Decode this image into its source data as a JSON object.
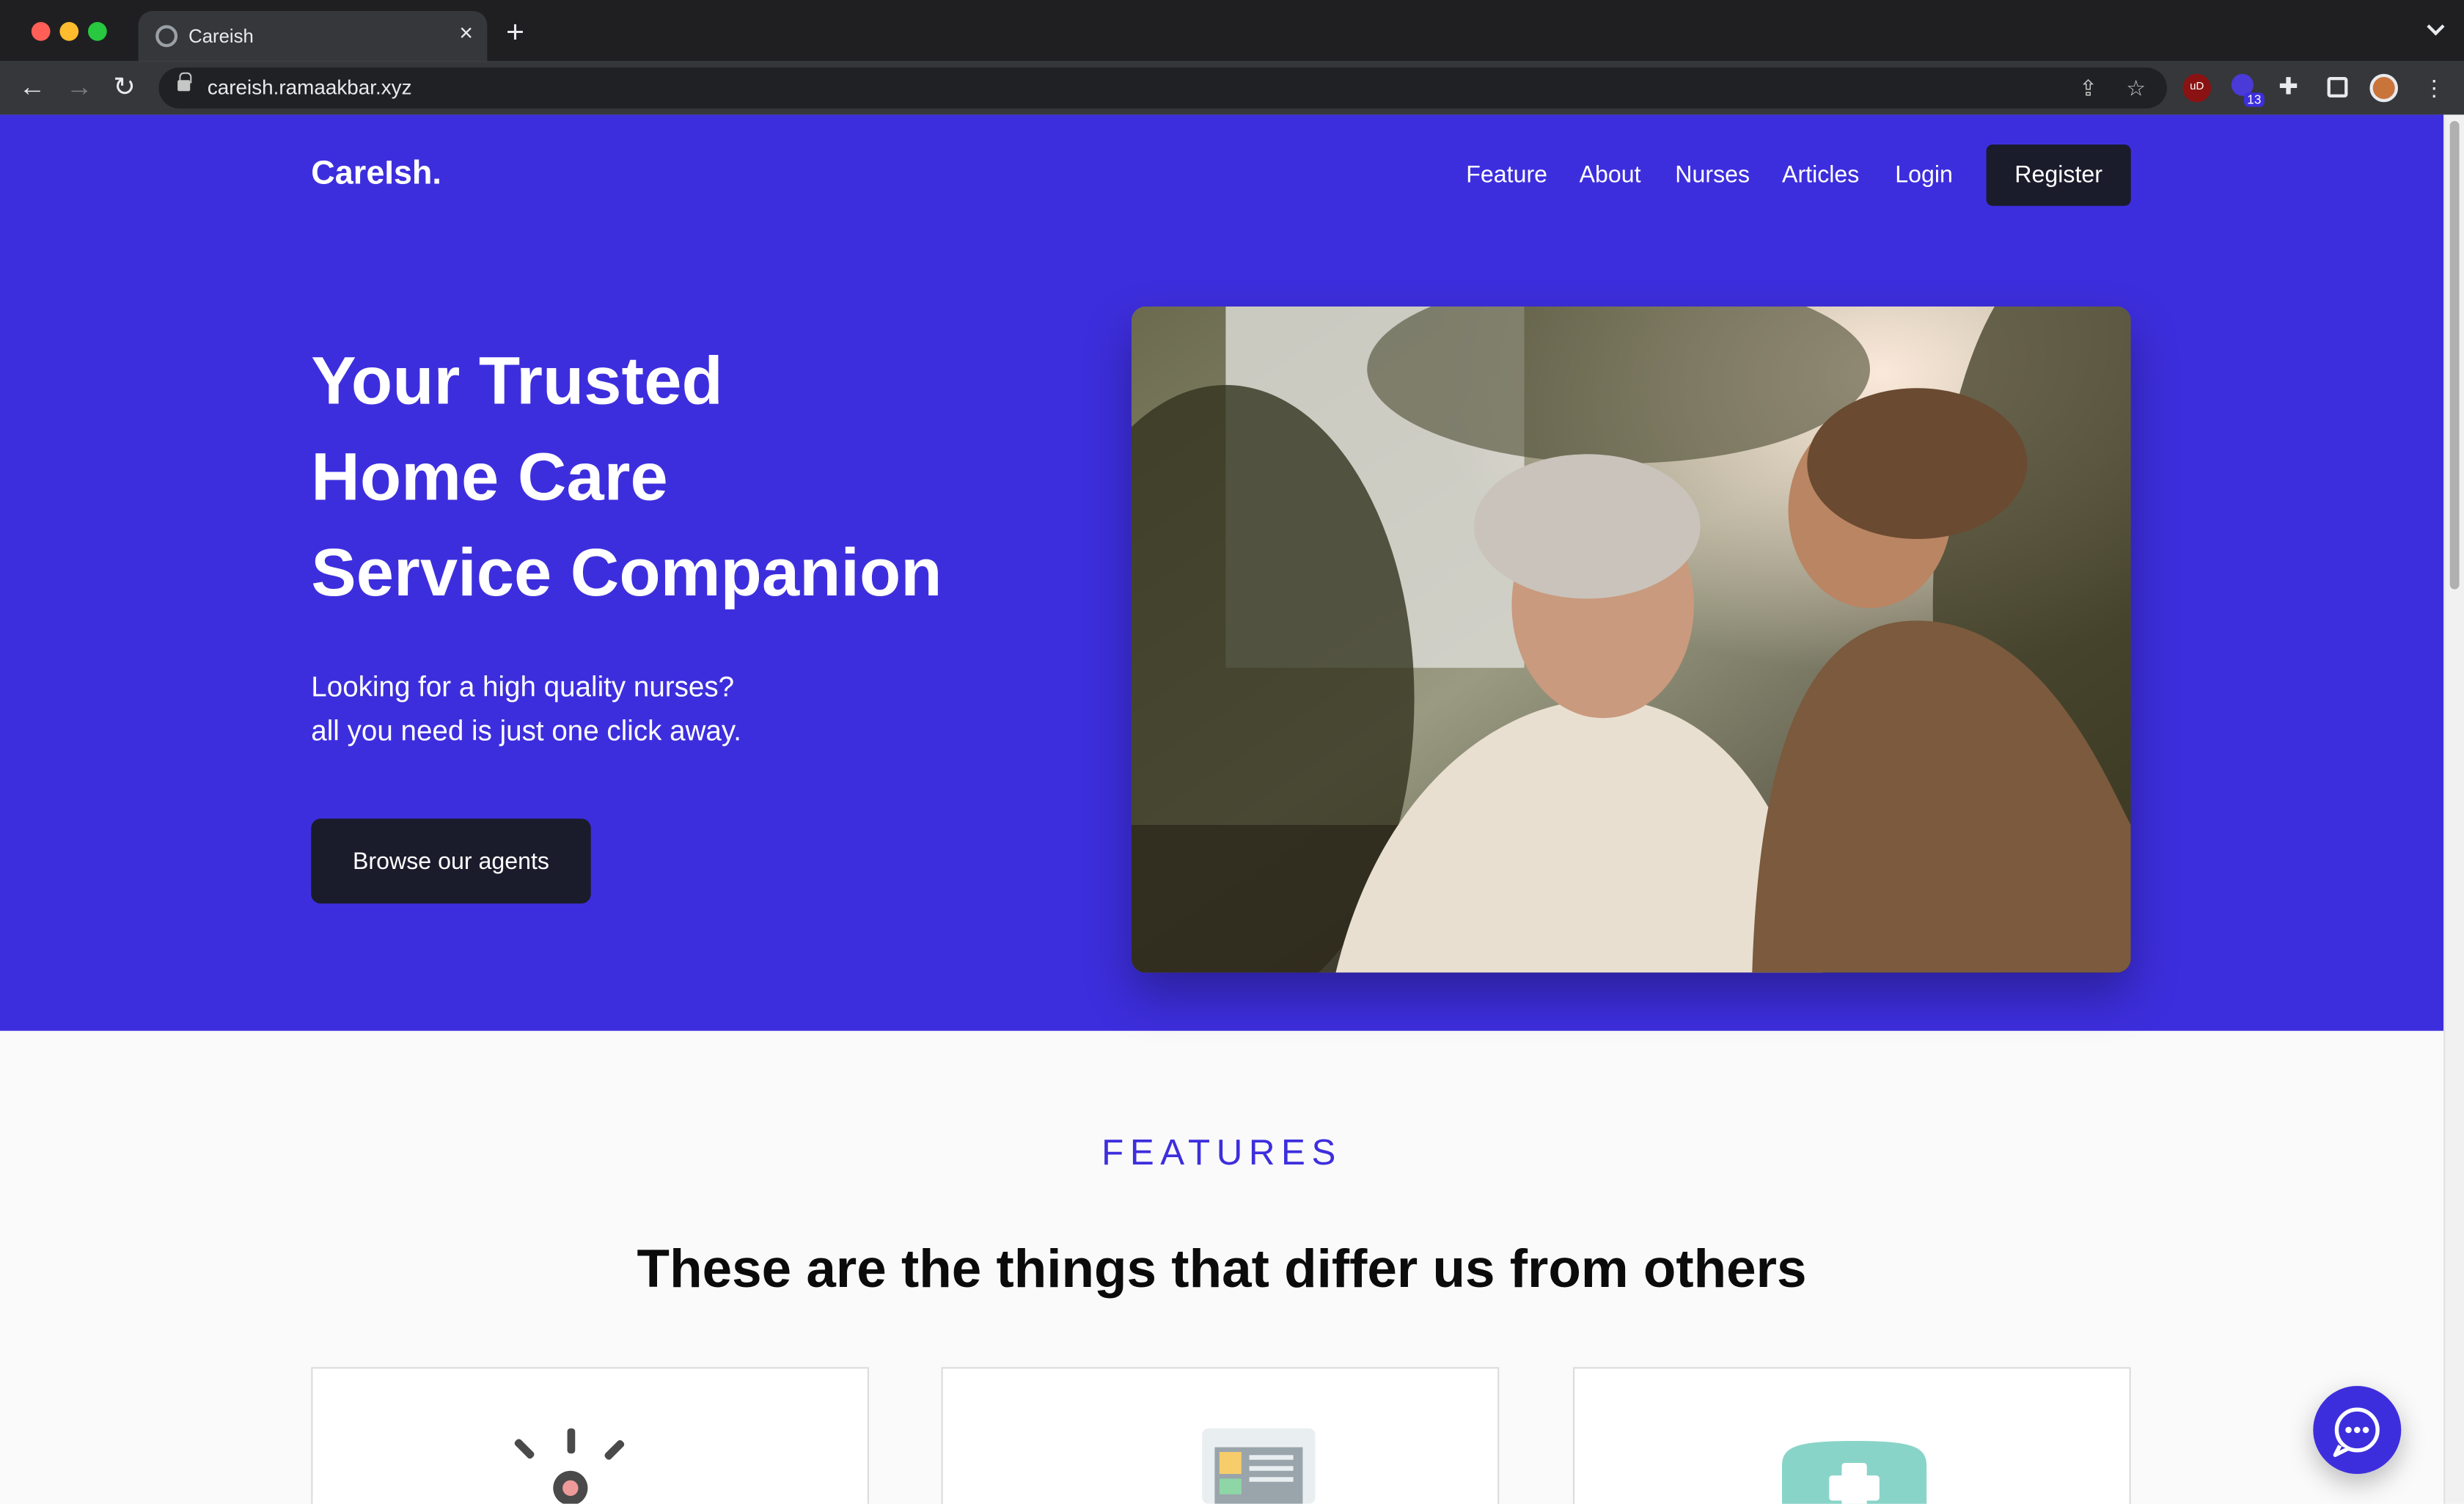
{
  "browser": {
    "tab_title": "Careish",
    "url": "careish.ramaakbar.xyz",
    "extension_badge": "13",
    "extension_ublock": "uD"
  },
  "site": {
    "logo": "CareIsh.",
    "nav": [
      "Feature",
      "About",
      "Nurses",
      "Articles",
      "Login"
    ],
    "register_label": "Register",
    "accent_color": "#3d2edd",
    "dark_color": "#1a1c2c"
  },
  "hero": {
    "title_lines": [
      "Your Trusted",
      "Home Care",
      "Service Companion"
    ],
    "subtitle_lines": [
      "Looking for a high quality nurses?",
      "all you need is just one click away."
    ],
    "cta_label": "Browse our agents"
  },
  "features": {
    "eyebrow": "FEATURES",
    "heading": "These are the things that differ us from others",
    "card_icons": [
      "alert-light-icon",
      "document-icon",
      "medical-kit-icon"
    ]
  }
}
